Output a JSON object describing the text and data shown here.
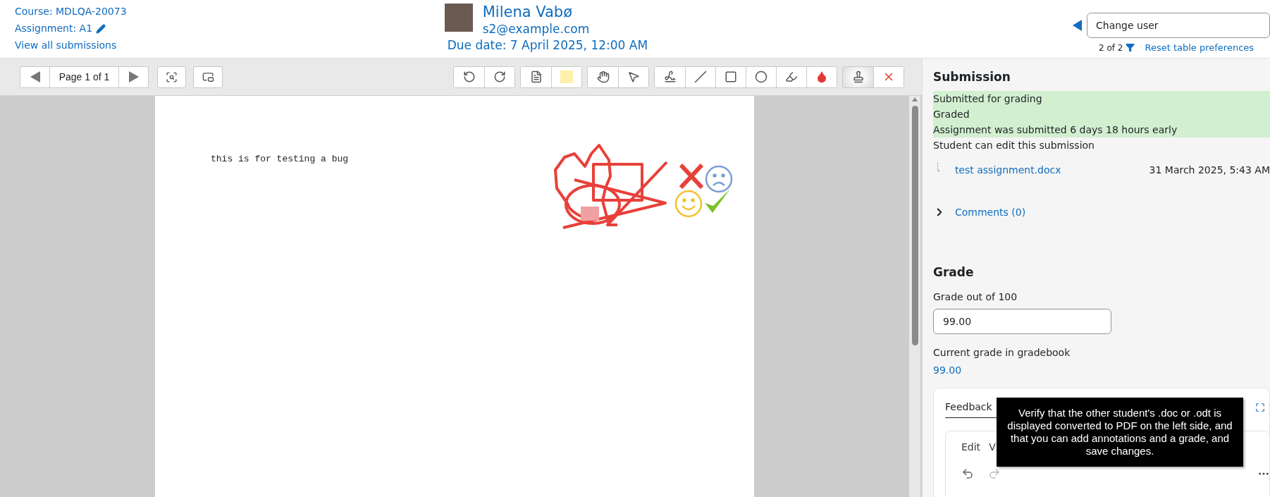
{
  "header": {
    "course_link": "Course: MDLQA-20073",
    "assignment_link": "Assignment: A1",
    "view_all_link": "View all submissions",
    "user_name": "Milena Vabø",
    "user_email": "s2@example.com",
    "due_date": "Due date: 7 April 2025, 12:00 AM",
    "change_user": "Change user",
    "pager": "2 of 2",
    "reset_link": "Reset table preferences"
  },
  "toolbar": {
    "page_label": "Page 1 of 1",
    "groups": [
      [
        {
          "kind": "rotate-left",
          "selected": false
        },
        {
          "kind": "rotate-right",
          "selected": false
        }
      ],
      [
        {
          "kind": "comment",
          "selected": false
        },
        {
          "kind": "swatch",
          "selected": false
        }
      ],
      [
        {
          "kind": "pan",
          "selected": false
        },
        {
          "kind": "select",
          "selected": false
        }
      ],
      [
        {
          "kind": "pen",
          "selected": false
        },
        {
          "kind": "line",
          "selected": false
        },
        {
          "kind": "rectangle",
          "selected": false
        },
        {
          "kind": "oval",
          "selected": false
        },
        {
          "kind": "highlight",
          "selected": false
        },
        {
          "kind": "color",
          "selected": false
        }
      ],
      [
        {
          "kind": "stamp",
          "selected": true
        },
        {
          "kind": "stamp-color",
          "selected": false
        }
      ]
    ]
  },
  "document": {
    "text": "this is for testing a bug"
  },
  "submission": {
    "heading": "Submission",
    "statuses": [
      {
        "text": "Submitted for grading",
        "highlighted": true
      },
      {
        "text": "Graded",
        "highlighted": true
      },
      {
        "text": "Assignment was submitted 6 days 18 hours early",
        "highlighted": true
      },
      {
        "text": "Student can edit this submission",
        "highlighted": false
      }
    ],
    "file_name": "test assignment.docx",
    "file_date": "31 March 2025, 5:43 AM",
    "comments": "Comments (0)",
    "comments_expanded": false
  },
  "grade": {
    "heading": "Grade",
    "label": "Grade out of 100",
    "value": "99.00",
    "gradebook_label": "Current grade in gradebook",
    "gradebook_value": "99.00"
  },
  "feedback": {
    "tab": "Feedback",
    "menu": [
      "Edit",
      "V"
    ]
  },
  "tooltip": "Verify that the other student's .doc or .odt is displayed converted to PDF on the left side, and that you can add annotations and a grade, and save changes."
}
